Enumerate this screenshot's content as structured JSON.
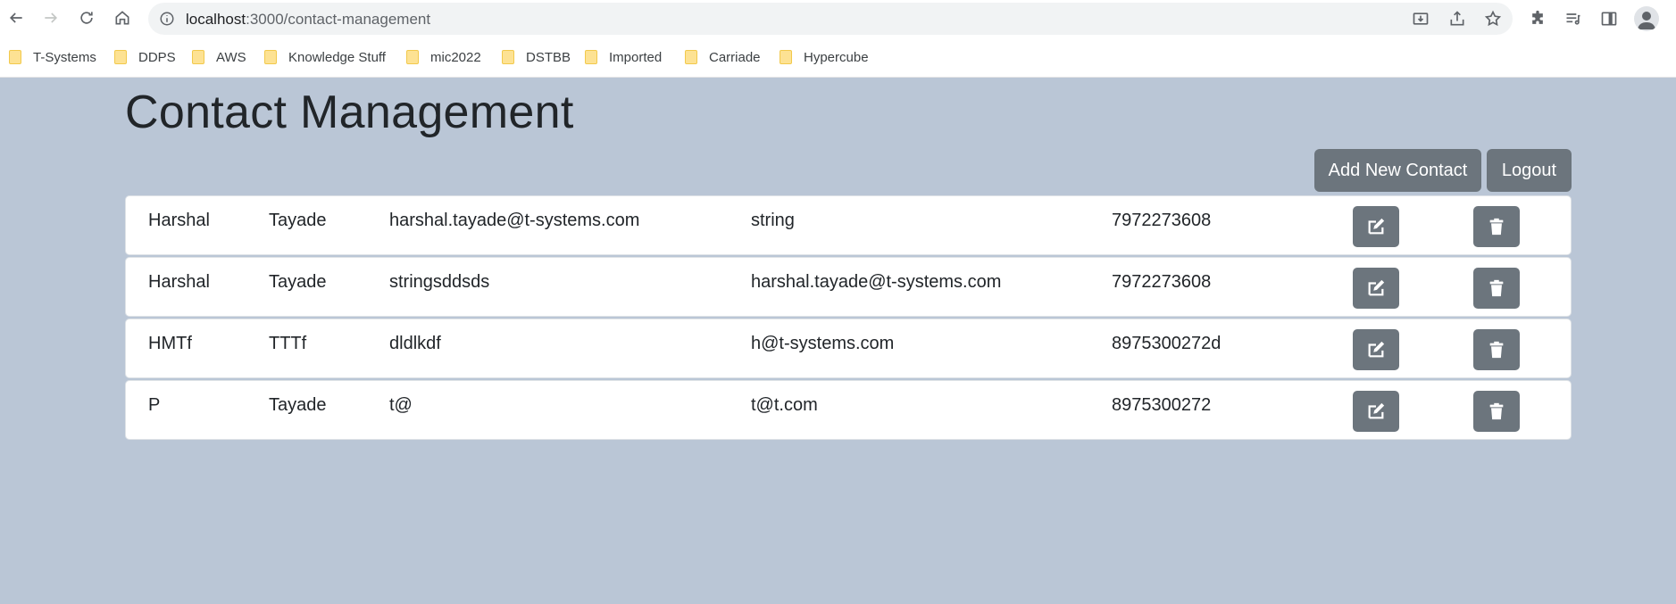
{
  "browser": {
    "url_host": "localhost",
    "url_path": ":3000/contact-management",
    "bookmarks": [
      {
        "label": "T-Systems"
      },
      {
        "label": "DDPS"
      },
      {
        "label": "AWS"
      },
      {
        "label": "Knowledge Stuff"
      },
      {
        "label": "mic2022"
      },
      {
        "label": "DSTBB"
      },
      {
        "label": "Imported"
      },
      {
        "label": "Carriade"
      },
      {
        "label": "Hypercube"
      }
    ]
  },
  "page": {
    "title": "Contact Management",
    "add_button": "Add New Contact",
    "logout_button": "Logout"
  },
  "contacts": [
    {
      "first_name": "Harshal",
      "last_name": "Tayade",
      "col3": "harshal.tayade@t-systems.com",
      "col4": "string",
      "phone": "7972273608"
    },
    {
      "first_name": "Harshal",
      "last_name": "Tayade",
      "col3": "stringsddsds",
      "col4": "harshal.tayade@t-systems.com",
      "phone": "7972273608"
    },
    {
      "first_name": "HMTf",
      "last_name": "TTTf",
      "col3": "dldlkdf",
      "col4": "h@t-systems.com",
      "phone": "8975300272d"
    },
    {
      "first_name": "P",
      "last_name": "Tayade",
      "col3": "t@",
      "col4": "t@t.com",
      "phone": "8975300272"
    }
  ],
  "colors": {
    "page_background": "#bac6d6",
    "button_secondary": "#6c757d",
    "text": "#212529"
  },
  "icons": {
    "edit": "edit-icon",
    "delete": "trash-icon"
  }
}
